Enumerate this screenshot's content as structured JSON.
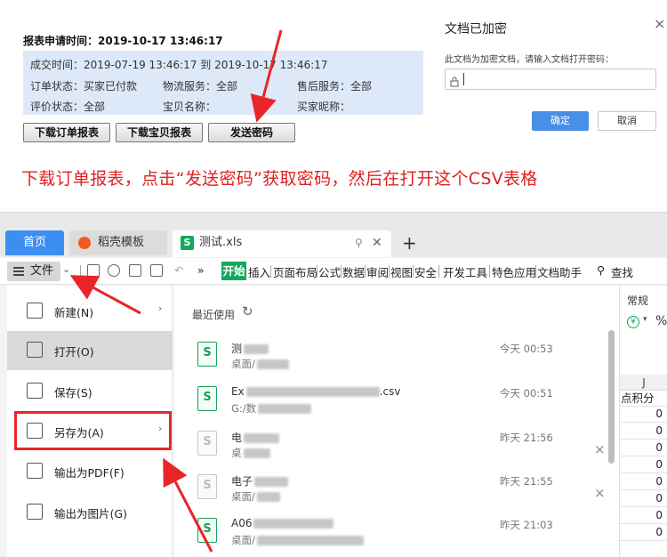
{
  "report": {
    "request_time_label": "报表申请时间：",
    "request_time": "2019-10-17 13:46:17",
    "row1": "成交时间：2019-07-19 13:46:17 到 2019-10-17 13:46:17",
    "order_status": "订单状态：买家已付款",
    "logistics": "物流服务：全部",
    "after_sale": "售后服务：全部",
    "review_status": "评价状态：全部",
    "item_name": "宝贝名称：",
    "buyer_nick": "买家昵称：",
    "btn_download_orders": "下载订单报表",
    "btn_download_items": "下载宝贝报表",
    "btn_send_password": "发送密码"
  },
  "dialog": {
    "title": "文档已加密",
    "close": "×",
    "description": "此文档为加密文档，请输入文档打开密码：",
    "ok": "确定",
    "cancel": "取消"
  },
  "instruction": "下载订单报表，点击“发送密码”获取密码，然后在打开这个CSV表格",
  "wps": {
    "tabs": {
      "home": "首页",
      "template": "稻壳模板",
      "file": "测试.xls",
      "file_icon": "S",
      "plus": "+"
    },
    "toolbar": {
      "file_menu": "文件",
      "more": "»",
      "start": "开始",
      "menus": [
        "插入",
        "页面布局",
        "公式",
        "数据",
        "审阅",
        "视图",
        "安全",
        "开发工具",
        "特色应用",
        "文档助手"
      ],
      "search": "查找"
    },
    "sidebar": [
      {
        "label": "新建(N)",
        "arrow": "›",
        "icon": "new-file-icon"
      },
      {
        "label": "打开(O)",
        "arrow": "",
        "icon": "folder-icon"
      },
      {
        "label": "保存(S)",
        "arrow": "",
        "icon": "save-icon"
      },
      {
        "label": "另存为(A)",
        "arrow": "›",
        "icon": "save-as-icon"
      },
      {
        "label": "输出为PDF(F)",
        "arrow": "",
        "icon": "pdf-icon"
      },
      {
        "label": "输出为图片(G)",
        "arrow": "",
        "icon": "image-icon"
      }
    ],
    "recent": {
      "heading": "最近使用",
      "files": [
        {
          "name": "测",
          "path": "桌面/",
          "time": "今天 00:53",
          "removable": false
        },
        {
          "name": "Ex",
          "name_suffix": ".csv",
          "path": "G:/数",
          "time": "今天 00:51",
          "removable": false
        },
        {
          "name": "电",
          "path": "桌",
          "time": "昨天 21:56",
          "removable": true
        },
        {
          "name": "电子",
          "path": "桌面/",
          "time": "昨天 21:55",
          "removable": true
        },
        {
          "name": "A06",
          "path": "桌面/",
          "time": "昨天 21:03",
          "removable": false
        }
      ],
      "remove_glyph": "×"
    },
    "sheet": {
      "format": "常规",
      "currency": "¥",
      "percent": "%",
      "column": "J",
      "header": "点积分",
      "values": [
        "0",
        "0",
        "0",
        "0",
        "0",
        "0",
        "0",
        "0"
      ]
    }
  }
}
